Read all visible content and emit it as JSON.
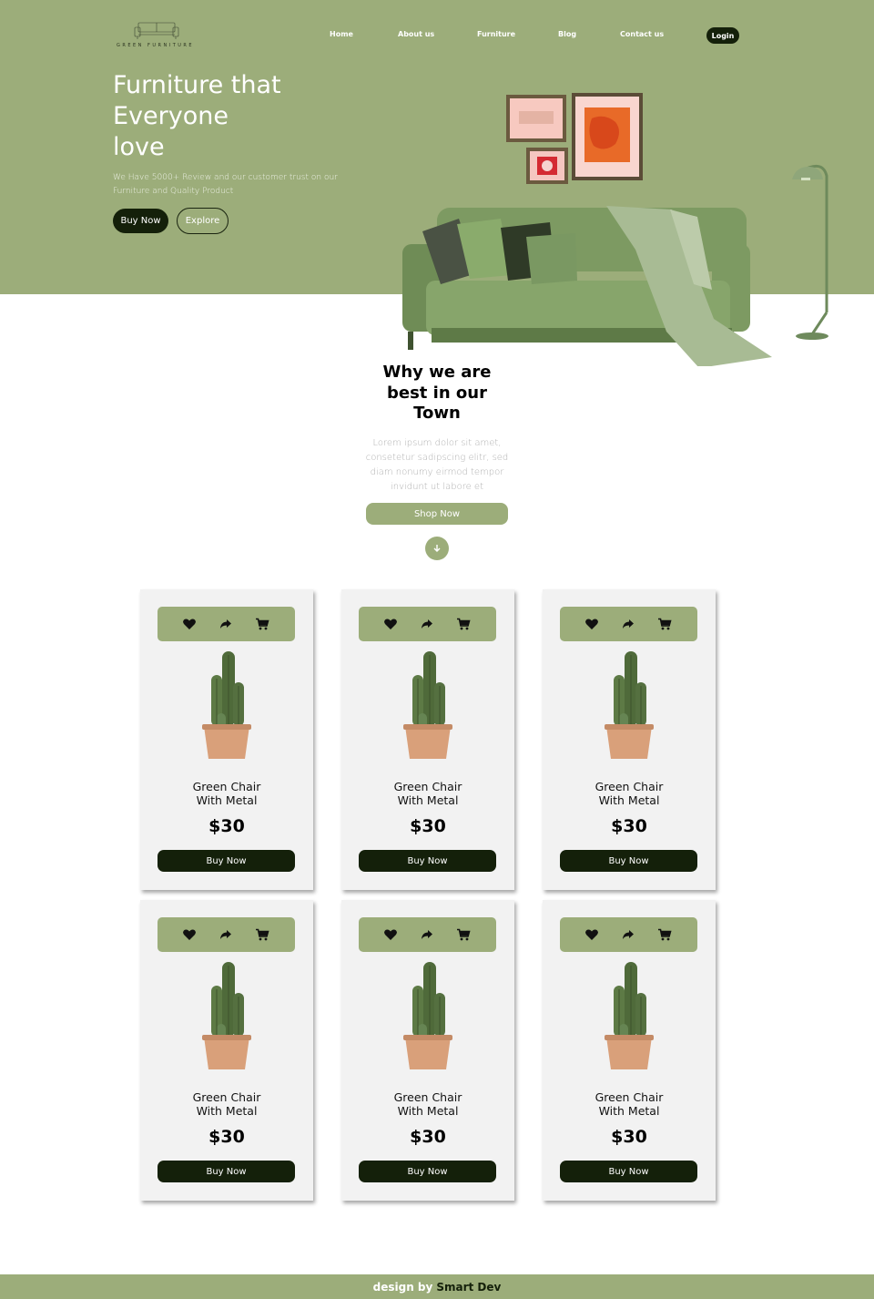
{
  "brand": {
    "logo_text": "GREEN FURNITURE"
  },
  "nav": {
    "items": [
      {
        "label": "Home"
      },
      {
        "label": "About us"
      },
      {
        "label": "Furniture"
      },
      {
        "label": "Blog"
      },
      {
        "label": "Contact us"
      }
    ],
    "login_label": "Login"
  },
  "hero": {
    "title_lines": [
      "Furniture that",
      "Everyone",
      "love"
    ],
    "subtitle": "We Have 5000+ Review and our customer trust on our Furniture and Quality Product",
    "buy_label": "Buy Now",
    "explore_label": "Explore"
  },
  "why": {
    "title_lines": [
      "Why we are",
      "best in our",
      "Town"
    ],
    "text": "Lorem ipsum dolor sit amet, consetetur sadipscing elitr, sed diam nonumy eirmod tempor invidunt ut labore et",
    "shop_label": "Shop Now",
    "down_icon": "arrow-down-icon"
  },
  "products": [
    {
      "name_lines": [
        "Green Chair",
        "With Metal"
      ],
      "price": "$30",
      "buy_label": "Buy Now"
    },
    {
      "name_lines": [
        "Green Chair",
        "With Metal"
      ],
      "price": "$30",
      "buy_label": "Buy Now"
    },
    {
      "name_lines": [
        "Green Chair",
        "With Metal"
      ],
      "price": "$30",
      "buy_label": "Buy Now"
    },
    {
      "name_lines": [
        "Green Chair",
        "With Metal"
      ],
      "price": "$30",
      "buy_label": "Buy Now"
    },
    {
      "name_lines": [
        "Green Chair",
        "With Metal"
      ],
      "price": "$30",
      "buy_label": "Buy Now"
    },
    {
      "name_lines": [
        "Green Chair",
        "With Metal"
      ],
      "price": "$30",
      "buy_label": "Buy Now"
    }
  ],
  "card_tools": [
    "heart-icon",
    "share-icon",
    "cart-icon"
  ],
  "footer": {
    "prefix": "design by",
    "author": "Smart Dev"
  },
  "colors": {
    "primary_green": "#9cad7a",
    "dark": "#14200a",
    "card_bg": "#f2f2f2"
  }
}
